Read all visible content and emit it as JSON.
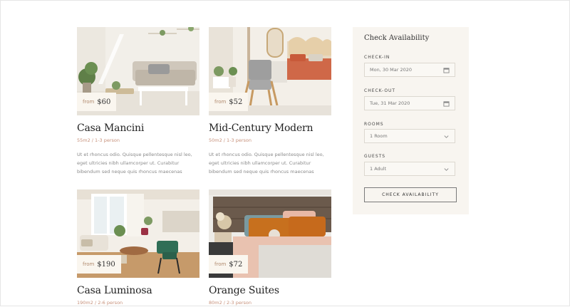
{
  "listings": [
    {
      "name": "Casa Mancini",
      "price_prefix": "from",
      "price": "$60",
      "meta": "55m2 / 1-3 person",
      "description": "Ut et rhoncus odio. Quisque pellentesque nisl leo, eget ultricies nibh ullamcorper ut. Curabitur bibendum sed neque quis rhoncus maecenas"
    },
    {
      "name": "Mid-Century Modern",
      "price_prefix": "from",
      "price": "$52",
      "meta": "50m2 / 1-3 person",
      "description": "Ut et rhoncus odio. Quisque pellentesque nisl leo, eget ultricies nibh ullamcorper ut. Curabitur bibendum sed neque quis rhoncus maecenas"
    },
    {
      "name": "Casa Luminosa",
      "price_prefix": "from",
      "price": "$190",
      "meta": "190m2 / 2-6 person"
    },
    {
      "name": "Orange Suites",
      "price_prefix": "from",
      "price": "$72",
      "meta": "80m2 / 2-3 person"
    }
  ],
  "availability": {
    "title": "Check Availability",
    "checkin_label": "CHECK-IN",
    "checkin_value": "Mon, 30 Mar 2020",
    "checkout_label": "CHECK-OUT",
    "checkout_value": "Tue, 31 Mar 2020",
    "rooms_label": "ROOMS",
    "rooms_value": "1 Room",
    "guests_label": "GUESTS",
    "guests_value": "1 Adult",
    "button_label": "CHECK AVAILABILITY"
  },
  "colors": {
    "accent": "#c7917b",
    "panel_bg": "#f8f5f0",
    "price_bg": "#faf6ef"
  },
  "icons": [
    "calendar-icon",
    "chevron-down-icon"
  ]
}
